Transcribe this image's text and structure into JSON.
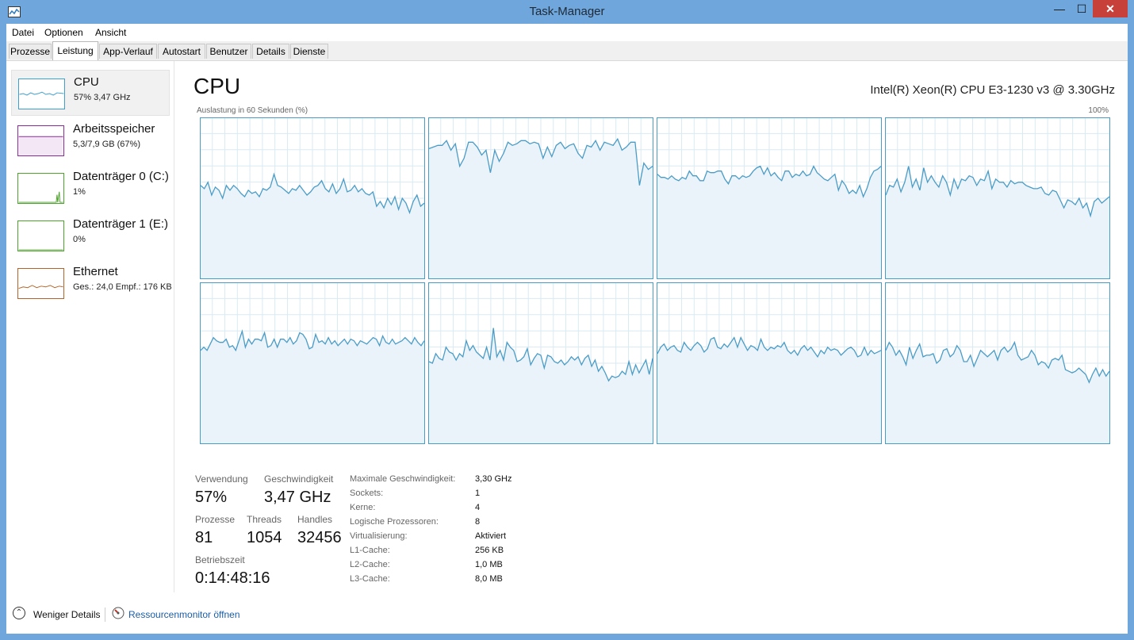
{
  "window": {
    "title": "Task-Manager",
    "min_glyph": "—",
    "max_glyph": "☐",
    "close_glyph": "✕"
  },
  "menu": [
    "Datei",
    "Optionen",
    "Ansicht"
  ],
  "tabs": [
    "Prozesse",
    "Leistung",
    "App-Verlauf",
    "Autostart",
    "Benutzer",
    "Details",
    "Dienste"
  ],
  "active_tab": "Leistung",
  "sidebar": [
    {
      "name": "CPU",
      "sub": "57% 3,47 GHz",
      "color": "#3e9fcd",
      "icon": "cpu-graph-icon"
    },
    {
      "name": "Arbeitsspeicher",
      "sub": "5,3/7,9 GB (67%)",
      "color": "#8b2c9b",
      "icon": "memory-graph-icon"
    },
    {
      "name": "Datenträger 0 (C:)",
      "sub": "1%",
      "color": "#4da32b",
      "icon": "disk-graph-icon"
    },
    {
      "name": "Datenträger 1 (E:)",
      "sub": "0%",
      "color": "#4da32b",
      "icon": "disk-graph-icon"
    },
    {
      "name": "Ethernet",
      "sub": "Ges.: 24,0  Empf.: 176 KB",
      "color": "#b4642a",
      "icon": "network-graph-icon"
    }
  ],
  "main": {
    "title": "CPU",
    "model": "Intel(R) Xeon(R) CPU E3-1230 v3 @ 3.30GHz",
    "graph_label_left": "Auslastung in 60 Sekunden (%)",
    "graph_label_right": "100%"
  },
  "chart_data": {
    "type": "area",
    "x_label": "Auslastung in 60 Sekunden (%)",
    "ylim": [
      0,
      100
    ],
    "grid": true,
    "color": "#4a9cc7",
    "fill": "#eaf3f9",
    "series": [
      {
        "values": [
          58,
          56,
          60,
          52,
          57,
          55,
          50,
          58,
          55,
          58,
          56,
          53,
          51,
          55,
          53,
          54,
          51,
          56,
          55,
          57,
          65,
          58,
          57,
          55,
          53,
          56,
          55,
          58,
          55,
          52,
          54,
          57,
          58,
          61,
          56,
          54,
          59,
          53,
          56,
          62,
          54,
          55,
          58,
          54,
          56,
          53,
          52,
          54,
          45,
          48,
          44,
          50,
          46,
          51,
          43,
          50,
          47,
          41,
          48,
          52,
          45,
          47
        ]
      },
      {
        "values": [
          81,
          82,
          83,
          83,
          86,
          80,
          84,
          70,
          75,
          85,
          85,
          82,
          77,
          80,
          66,
          80,
          73,
          78,
          85,
          83,
          84,
          86,
          86,
          84,
          85,
          84,
          75,
          82,
          76,
          83,
          85,
          81,
          83,
          84,
          78,
          75,
          83,
          82,
          86,
          80,
          85,
          84,
          83,
          87,
          80,
          82,
          85,
          85,
          58,
          72,
          68,
          70
        ]
      },
      {
        "values": [
          65,
          63,
          63,
          62,
          64,
          62,
          61,
          63,
          62,
          67,
          64,
          64,
          61,
          61,
          67,
          66,
          66,
          67,
          67,
          62,
          59,
          64,
          64,
          62,
          64,
          63,
          64,
          67,
          69,
          70,
          65,
          69,
          64,
          66,
          63,
          61,
          67,
          67,
          63,
          65,
          64,
          67,
          64,
          65,
          70,
          66,
          64,
          62,
          61,
          63,
          65,
          55,
          61,
          58,
          53,
          55,
          53,
          58,
          51,
          56,
          63,
          67,
          68,
          70
        ]
      },
      {
        "values": [
          52,
          58,
          57,
          62,
          54,
          60,
          70,
          57,
          62,
          55,
          69,
          60,
          64,
          60,
          57,
          64,
          60,
          52,
          62,
          56,
          62,
          61,
          64,
          63,
          58,
          62,
          61,
          67,
          56,
          62,
          60,
          60,
          57,
          61,
          59,
          60,
          60,
          58,
          57,
          56,
          56,
          57,
          53,
          52,
          55,
          54,
          49,
          44,
          49,
          48,
          46,
          50,
          44,
          47,
          39,
          48,
          50,
          47,
          49,
          51
        ]
      },
      {
        "values": [
          58,
          60,
          58,
          62,
          66,
          64,
          63,
          63,
          65,
          60,
          61,
          58,
          64,
          70,
          60,
          65,
          62,
          65,
          65,
          64,
          69,
          60,
          61,
          65,
          60,
          65,
          65,
          63,
          66,
          62,
          64,
          69,
          68,
          65,
          59,
          60,
          68,
          63,
          64,
          62,
          66,
          62,
          64,
          61,
          63,
          65,
          62,
          65,
          64,
          61,
          64,
          63,
          62,
          64,
          66,
          65,
          61,
          67,
          63,
          62,
          65,
          62,
          63,
          64,
          66,
          64,
          62,
          66,
          63,
          61,
          64
        ]
      },
      {
        "values": [
          51,
          50,
          56,
          53,
          52,
          60,
          57,
          56,
          52,
          56,
          54,
          64,
          58,
          61,
          57,
          55,
          53,
          60,
          52,
          72,
          54,
          58,
          52,
          63,
          60,
          58,
          51,
          52,
          54,
          59,
          49,
          53,
          56,
          55,
          47,
          55,
          54,
          51,
          50,
          52,
          49,
          51,
          54,
          52,
          54,
          49,
          53,
          55,
          48,
          52,
          45,
          48,
          44,
          39,
          42,
          41,
          42,
          45,
          43,
          51,
          43,
          49,
          44,
          48,
          52,
          43,
          53
        ]
      },
      {
        "values": [
          56,
          60,
          62,
          58,
          60,
          61,
          58,
          57,
          63,
          60,
          58,
          61,
          63,
          61,
          57,
          59,
          65,
          66,
          60,
          59,
          62,
          60,
          63,
          66,
          60,
          66,
          62,
          58,
          61,
          60,
          58,
          65,
          60,
          58,
          60,
          59,
          61,
          60,
          63,
          58,
          56,
          58,
          55,
          59,
          61,
          58,
          60,
          57,
          54,
          58,
          56,
          60,
          58,
          59,
          58,
          55,
          57,
          59,
          60,
          58,
          54,
          55,
          60,
          55,
          58,
          56,
          57,
          58
        ]
      },
      {
        "values": [
          58,
          63,
          60,
          55,
          58,
          54,
          49,
          60,
          53,
          58,
          62,
          54,
          55,
          55,
          56,
          50,
          52,
          58,
          59,
          54,
          56,
          61,
          58,
          51,
          51,
          55,
          48,
          53,
          58,
          56,
          54,
          56,
          58,
          52,
          58,
          60,
          57,
          59,
          63,
          55,
          52,
          53,
          54,
          58,
          55,
          49,
          51,
          50,
          47,
          52,
          53,
          52,
          55,
          46,
          45,
          44,
          45,
          47,
          45,
          43,
          38,
          43,
          47,
          42,
          46,
          42,
          45
        ]
      }
    ]
  },
  "stats": {
    "verwendung_label": "Verwendung",
    "verwendung": "57%",
    "geschw_label": "Geschwindigkeit",
    "geschw": "3,47 GHz",
    "prozesse_label": "Prozesse",
    "prozesse": "81",
    "threads_label": "Threads",
    "threads": "1054",
    "handles_label": "Handles",
    "handles": "32456",
    "betrieb_label": "Betriebszeit",
    "betrieb": "0:14:48:16"
  },
  "info": [
    {
      "label": "Maximale Geschwindigkeit:",
      "value": "3,30 GHz"
    },
    {
      "label": "Sockets:",
      "value": "1"
    },
    {
      "label": "Kerne:",
      "value": "4"
    },
    {
      "label": "Logische Prozessoren:",
      "value": "8"
    },
    {
      "label": "Virtualisierung:",
      "value": "Aktiviert"
    },
    {
      "label": "L1-Cache:",
      "value": "256 KB"
    },
    {
      "label": "L2-Cache:",
      "value": "1,0 MB"
    },
    {
      "label": "L3-Cache:",
      "value": "8,0 MB"
    }
  ],
  "footer": {
    "fewer_details": "Weniger Details",
    "resource_monitor": "Ressourcenmonitor öffnen"
  }
}
